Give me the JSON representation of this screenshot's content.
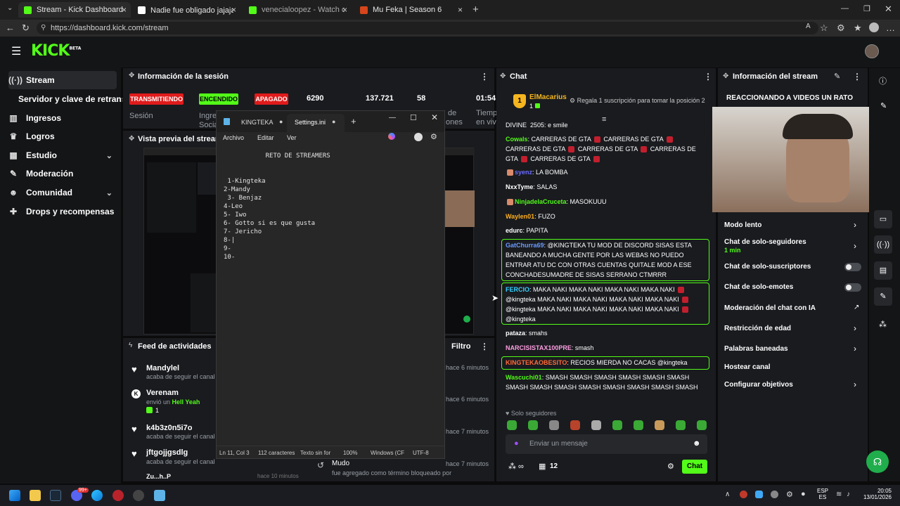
{
  "browser": {
    "tabs": [
      {
        "title": "Stream - Kick Dashboard",
        "color": "#53fc18"
      },
      {
        "title": "Nadie fue obligado jajajaja😂 | T",
        "color": "#ffffff"
      },
      {
        "title": "venecialoopez - Watch clips on Ki",
        "color": "#53fc18"
      },
      {
        "title": "Mu Feka | Season 6",
        "color": "#d6451b"
      }
    ],
    "url": "https://dashboard.kick.com/stream"
  },
  "logo": {
    "text": "KICK",
    "beta": "BETA"
  },
  "sidebar": {
    "items": [
      {
        "label": "Stream",
        "icon": "broadcast-icon"
      },
      {
        "label": "Servidor y clave de retransmisión",
        "icon": ""
      },
      {
        "label": "Ingresos",
        "icon": "bar-chart-icon"
      },
      {
        "label": "Logros",
        "icon": "trophy-icon"
      },
      {
        "label": "Estudio",
        "icon": "studio-icon"
      },
      {
        "label": "Moderación",
        "icon": "wrench-icon"
      },
      {
        "label": "Comunidad",
        "icon": "people-icon"
      },
      {
        "label": "Drops y recompensas",
        "icon": "gift-icon"
      }
    ]
  },
  "session": {
    "title": "Información de la sesión",
    "badges": {
      "live": "TRANSMITIENDO",
      "on": "ENCENDIDO",
      "off": "APAGADO"
    },
    "stats": [
      "6290",
      "137.721",
      "58",
      "01:54"
    ],
    "labels": [
      "Sesión",
      "Ingre",
      "Socia",
      "de",
      "ones",
      "Tiemp",
      "en viv"
    ]
  },
  "preview": {
    "title": "Vista previa del stream"
  },
  "feed": {
    "title": "Feed de actividades",
    "filter": "Filtro",
    "items": [
      {
        "name": "Mandylel",
        "sub": "acaba de seguir el canal",
        "time": "hace 6 minutos",
        "icon": "heart-icon"
      },
      {
        "name": "Verenam",
        "sub_prefix": "envió un ",
        "sub_gift": "Hell Yeah",
        "count": "1",
        "time": "hace 6 minutos",
        "icon": "kick-icon"
      },
      {
        "name": "k4b3z0n5i7o",
        "sub": "acaba de seguir el canal",
        "time": "hace 7 minutos",
        "icon": "heart-icon"
      },
      {
        "name": "jftgojjgsdlg",
        "sub": "acaba de seguir el canal",
        "time": "hace 7 minutos",
        "icon": "heart-icon"
      },
      {
        "name": "Mudo",
        "sub": "fue agregado como término bloqueado por",
        "time": "hace 7 minutos",
        "icon": "history-icon"
      }
    ],
    "cut_name": "Zu...h..P",
    "cut_time": "hace 10 minutos"
  },
  "notepad": {
    "tab1": "KINGTEKA",
    "tab2": "Settings.ini",
    "menu": [
      "Archivo",
      "Editar",
      "Ver"
    ],
    "text": "           RETO DE STREAMERS\n\n\n 1-Kingteka\n2-Mandy\n 3- Benjaz\n4-Leo\n5- Iwo\n6- Gotto si es que gusta\n7- Jericho\n8-|\n9-\n10-",
    "status": [
      "Ln 11, Col 3",
      "112 caracteres",
      "Texto sin for",
      "100%",
      "Windows (CF",
      "UTF-8"
    ]
  },
  "chat": {
    "title": "Chat",
    "top_user": "ElMacarius",
    "top_rank": "1",
    "top_count": "1",
    "gift_prompt": "Regala 1 suscripción para tomar la posición 2",
    "cut_line": "DIVINE_2505: e smile",
    "messages": [
      {
        "user": "Cowals",
        "color": "#53fc18",
        "text": "CARRERAS DE GTA [e] CARRERAS DE GTA [e] CARRERAS DE GTA [e] CARRERAS DE GTA [e] CARRERAS DE GTA [e] CARRERAS DE GTA [e]"
      },
      {
        "user": "syenz",
        "color": "#6b6bff",
        "text": "LA BOMBA"
      },
      {
        "user": "NxxTyme",
        "color": "#ffffff",
        "text": "SALAS"
      },
      {
        "user": "NinjadelaCruceta",
        "color": "#53fc18",
        "text": "MASOKUUU"
      },
      {
        "user": "Waylen01",
        "color": "#ffb020",
        "text": "FUZO"
      },
      {
        "user": "edurc",
        "color": "#ffffff",
        "text": "PAPITA"
      },
      {
        "user": "GatChurra69",
        "color": "#6b9bff",
        "text": "@KINGTEKA TU MOD DE DISCORD SISAS ESTA BANEANDO A MUCHA GENTE POR LAS WEBAS NO PUEDO ENTRAR ATU DC CON OTRAS CUENTAS QUITALE MOD A ESE CONCHADESUMADRE DE SISAS SERRANO CTMRRR"
      },
      {
        "user": "FERCIO",
        "color": "#35d0ff",
        "text": "MAKA NAKI MAKA NAKI MAKA NAKI MAKA NAKI [e] @kingteka MAKA NAKI MAKA NAKI MAKA NAKI MAKA NAKI [e] @kingteka MAKA NAKI MAKA NAKI MAKA NAKI MAKA NAKI [e] @kingteka"
      },
      {
        "user": "pataza",
        "color": "#ffffff",
        "text": "smahs"
      },
      {
        "user": "NARCISISTAX100PRE",
        "color": "#ff9ee0",
        "text": "smash"
      },
      {
        "user": "KINGTEKAOBESITO",
        "color": "#ff6a3a",
        "text": "RECIOS MIERDA NO CACAS @kingteka"
      },
      {
        "user": "Wascuchi01",
        "color": "#53fc18",
        "text": "SMASH SMASH SMASH SMASH SMASH SMASH SMASH SMASH SMASH SMASH SMASH SMASH SMASH SMASH"
      }
    ],
    "followers_only": "Solo seguidores",
    "placeholder": "Enviar un mensaje",
    "count": "12",
    "send": "Chat"
  },
  "stream_info": {
    "title": "Información del stream",
    "stream_title": "REACCIONANDO A VIDEOS UN RATO",
    "items": [
      {
        "label": "Modo lento",
        "control": "chevron"
      },
      {
        "label": "Chat de solo-seguidores",
        "sub": "1 min",
        "control": "chevron"
      },
      {
        "label": "Chat de solo-suscriptores",
        "control": "toggle"
      },
      {
        "label": "Chat de solo-emotes",
        "control": "toggle"
      },
      {
        "label": "Moderación del chat con IA",
        "control": "external"
      },
      {
        "label": "Restricción de edad",
        "control": "chevron"
      },
      {
        "label": "Palabras baneadas",
        "control": "chevron"
      },
      {
        "label": "Hostear canal",
        "control": "none"
      },
      {
        "label": "Configurar objetivos",
        "control": "chevron"
      }
    ]
  },
  "taskbar": {
    "lang": "ESP",
    "region": "ES",
    "time": "20:05",
    "date": "13/01/2026",
    "badge": "99+"
  }
}
